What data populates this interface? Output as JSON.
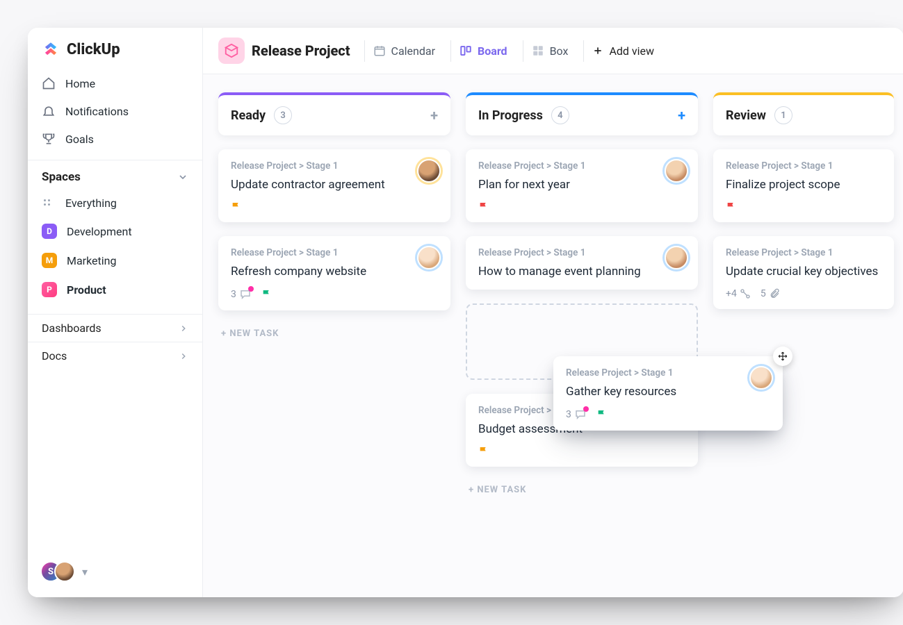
{
  "app_name": "ClickUp",
  "sidebar": {
    "nav": [
      {
        "label": "Home",
        "icon": "home"
      },
      {
        "label": "Notifications",
        "icon": "bell"
      },
      {
        "label": "Goals",
        "icon": "trophy"
      }
    ],
    "spaces_header": "Spaces",
    "spaces": [
      {
        "label": "Everything",
        "type": "all"
      },
      {
        "label": "Development",
        "initial": "D",
        "color": "#8b5cf6"
      },
      {
        "label": "Marketing",
        "initial": "M",
        "color": "#f59e0b"
      },
      {
        "label": "Product",
        "initial": "P",
        "color": "#ff5fa2",
        "active": true
      }
    ],
    "bottom": [
      {
        "label": "Dashboards"
      },
      {
        "label": "Docs"
      }
    ],
    "footer_avatar_initial": "S"
  },
  "header": {
    "project_title": "Release Project",
    "views": [
      {
        "label": "Calendar",
        "icon": "calendar"
      },
      {
        "label": "Board",
        "icon": "board",
        "active": true
      },
      {
        "label": "Box",
        "icon": "box"
      }
    ],
    "add_view": "Add view"
  },
  "board": {
    "columns": [
      {
        "name": "Ready",
        "count": 3,
        "accent": "#8b5cf6",
        "cards": [
          {
            "breadcrumb": "Release Project > Stage 1",
            "title": "Update contractor agreement",
            "flag": "#f59e0b",
            "avatar": "face1-ring-yellow"
          },
          {
            "breadcrumb": "Release Project > Stage 1",
            "title": "Refresh company website",
            "comments": 3,
            "comment_dot": true,
            "flag": "#10b981",
            "avatar": "face3-ring-blue"
          }
        ],
        "new_task_label": "+ NEW TASK"
      },
      {
        "name": "In Progress",
        "count": 4,
        "accent": "#1d8bff",
        "add_blue": true,
        "cards": [
          {
            "breadcrumb": "Release Project > Stage 1",
            "title": "Plan for next year",
            "flag": "#ef4444",
            "avatar": "face2-ring-blue"
          },
          {
            "breadcrumb": "Release Project > Stage 1",
            "title": "How to manage event planning",
            "avatar": "face2-ring-blue"
          },
          {
            "placeholder": true
          },
          {
            "breadcrumb": "Release Project > Stage 1",
            "title": "Budget assessment",
            "flag": "#f59e0b"
          }
        ],
        "new_task_label": "+ NEW TASK"
      },
      {
        "name": "Review",
        "count": 1,
        "accent": "#fbbf24",
        "cards": [
          {
            "breadcrumb": "Release Project > Stage 1",
            "title": "Finalize project scope",
            "flag": "#ef4444"
          },
          {
            "breadcrumb": "Release Project > Stage 1",
            "title": "Update crucial key objectives",
            "subtasks": "+4",
            "attachments": 5
          }
        ]
      }
    ],
    "dragging_card": {
      "breadcrumb": "Release Project > Stage 1",
      "title": "Gather key resources",
      "comments": 3,
      "comment_dot": true,
      "flag": "#10b981",
      "avatar": "face3-ring-blue"
    }
  }
}
